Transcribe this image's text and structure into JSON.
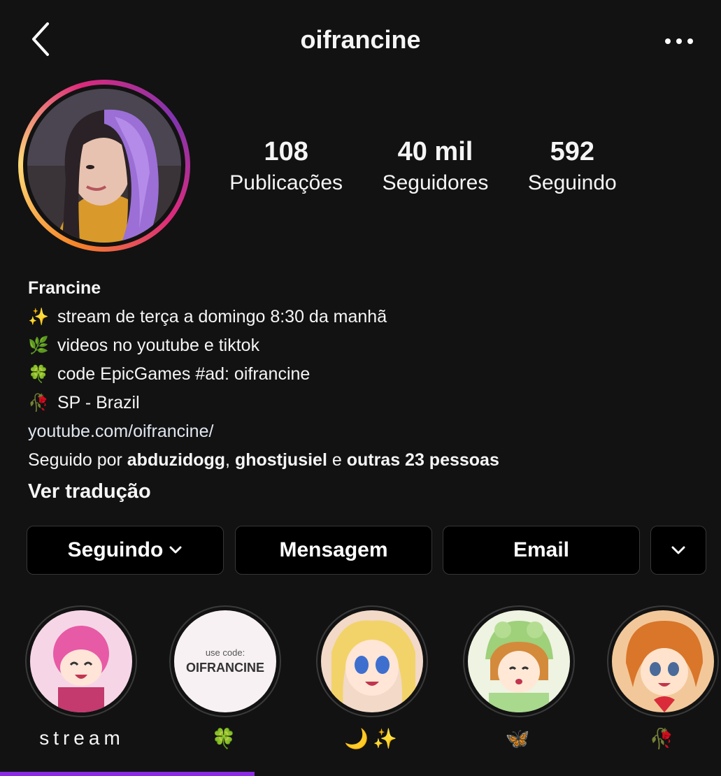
{
  "header": {
    "username": "oifrancine",
    "back_icon": "chevron-left-icon",
    "more_icon": "more-horizontal-icon"
  },
  "profile": {
    "avatar_alt": "profile photo"
  },
  "stats": [
    {
      "value": "108",
      "label": "Publicações"
    },
    {
      "value": "40 mil",
      "label": "Seguidores"
    },
    {
      "value": "592",
      "label": "Seguindo"
    }
  ],
  "bio": {
    "name": "Francine",
    "lines": [
      {
        "emoji": "✨",
        "text": "stream de terça a domingo 8:30 da manhã"
      },
      {
        "emoji": "🌿",
        "text": "videos no youtube e tiktok"
      },
      {
        "emoji": "🍀",
        "text": "code EpicGames #ad: oifrancine"
      },
      {
        "emoji": "🥀",
        "text": "SP - Brazil"
      }
    ],
    "link": "youtube.com/oifrancine/",
    "followed_prefix": "Seguido por ",
    "followed_user1": "abduzidogg",
    "followed_sep": ", ",
    "followed_user2": "ghostjusiel",
    "followed_and": " e ",
    "followed_others": "outras 23 pessoas",
    "translate": "Ver tradução"
  },
  "actions": {
    "following_label": "Seguindo",
    "message_label": "Mensagem",
    "email_label": "Email"
  },
  "highlights": [
    {
      "label": "stream"
    },
    {
      "label": "🍀",
      "cover_small": "use code:",
      "cover_big": "OIFRANCINE"
    },
    {
      "label": "🌙✨"
    },
    {
      "label": "🦋"
    },
    {
      "label": "🥀"
    }
  ],
  "colors": {
    "background": "#121212",
    "button_bg": "#000000",
    "button_border": "#363636",
    "accent": "#8a2be2"
  }
}
